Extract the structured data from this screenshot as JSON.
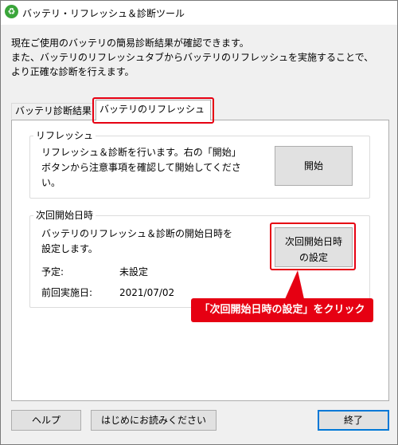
{
  "window": {
    "title": "バッテリ・リフレッシュ＆診断ツール",
    "icon": "battery-tool-icon",
    "icon_glyph": "♻"
  },
  "intro": {
    "lines": [
      "現在ご使用のバッテリの簡易診断結果が確認できます。",
      "また、バッテリのリフレッシュタブからバッテリのリフレッシュを実施することで、",
      "より正確な診断を行えます。"
    ]
  },
  "tabs": [
    {
      "label": "バッテリ診断結果",
      "selected": false
    },
    {
      "label": "バッテリのリフレッシュ",
      "selected": true
    }
  ],
  "refresh_group": {
    "legend": "リフレッシュ",
    "description_lines": [
      "リフレッシュ＆診断を行います。右の「開始」",
      "ボタンから注意事項を確認して開始してくださ",
      "い。"
    ],
    "start_button": "開始"
  },
  "schedule_group": {
    "legend": "次回開始日時",
    "description_lines": [
      "バッテリのリフレッシュ＆診断の開始日時を",
      "設定します。"
    ],
    "planned_label": "予定:",
    "planned_value": "未設定",
    "last_label": "前回実施日:",
    "last_value": "2021/07/02",
    "schedule_button_lines": [
      "次回開始日時",
      "の設定"
    ]
  },
  "annotation": {
    "callout": "「次回開始日時の設定」をクリック",
    "highlight_color": "#e60012"
  },
  "footer": {
    "help_button": "ヘルプ",
    "readme_button": "はじめにお読みください",
    "close_button": "終了"
  },
  "colors": {
    "accent": "#0078d7",
    "window_bg": "#f0f0f0",
    "button_bg": "#e1e1e1"
  }
}
